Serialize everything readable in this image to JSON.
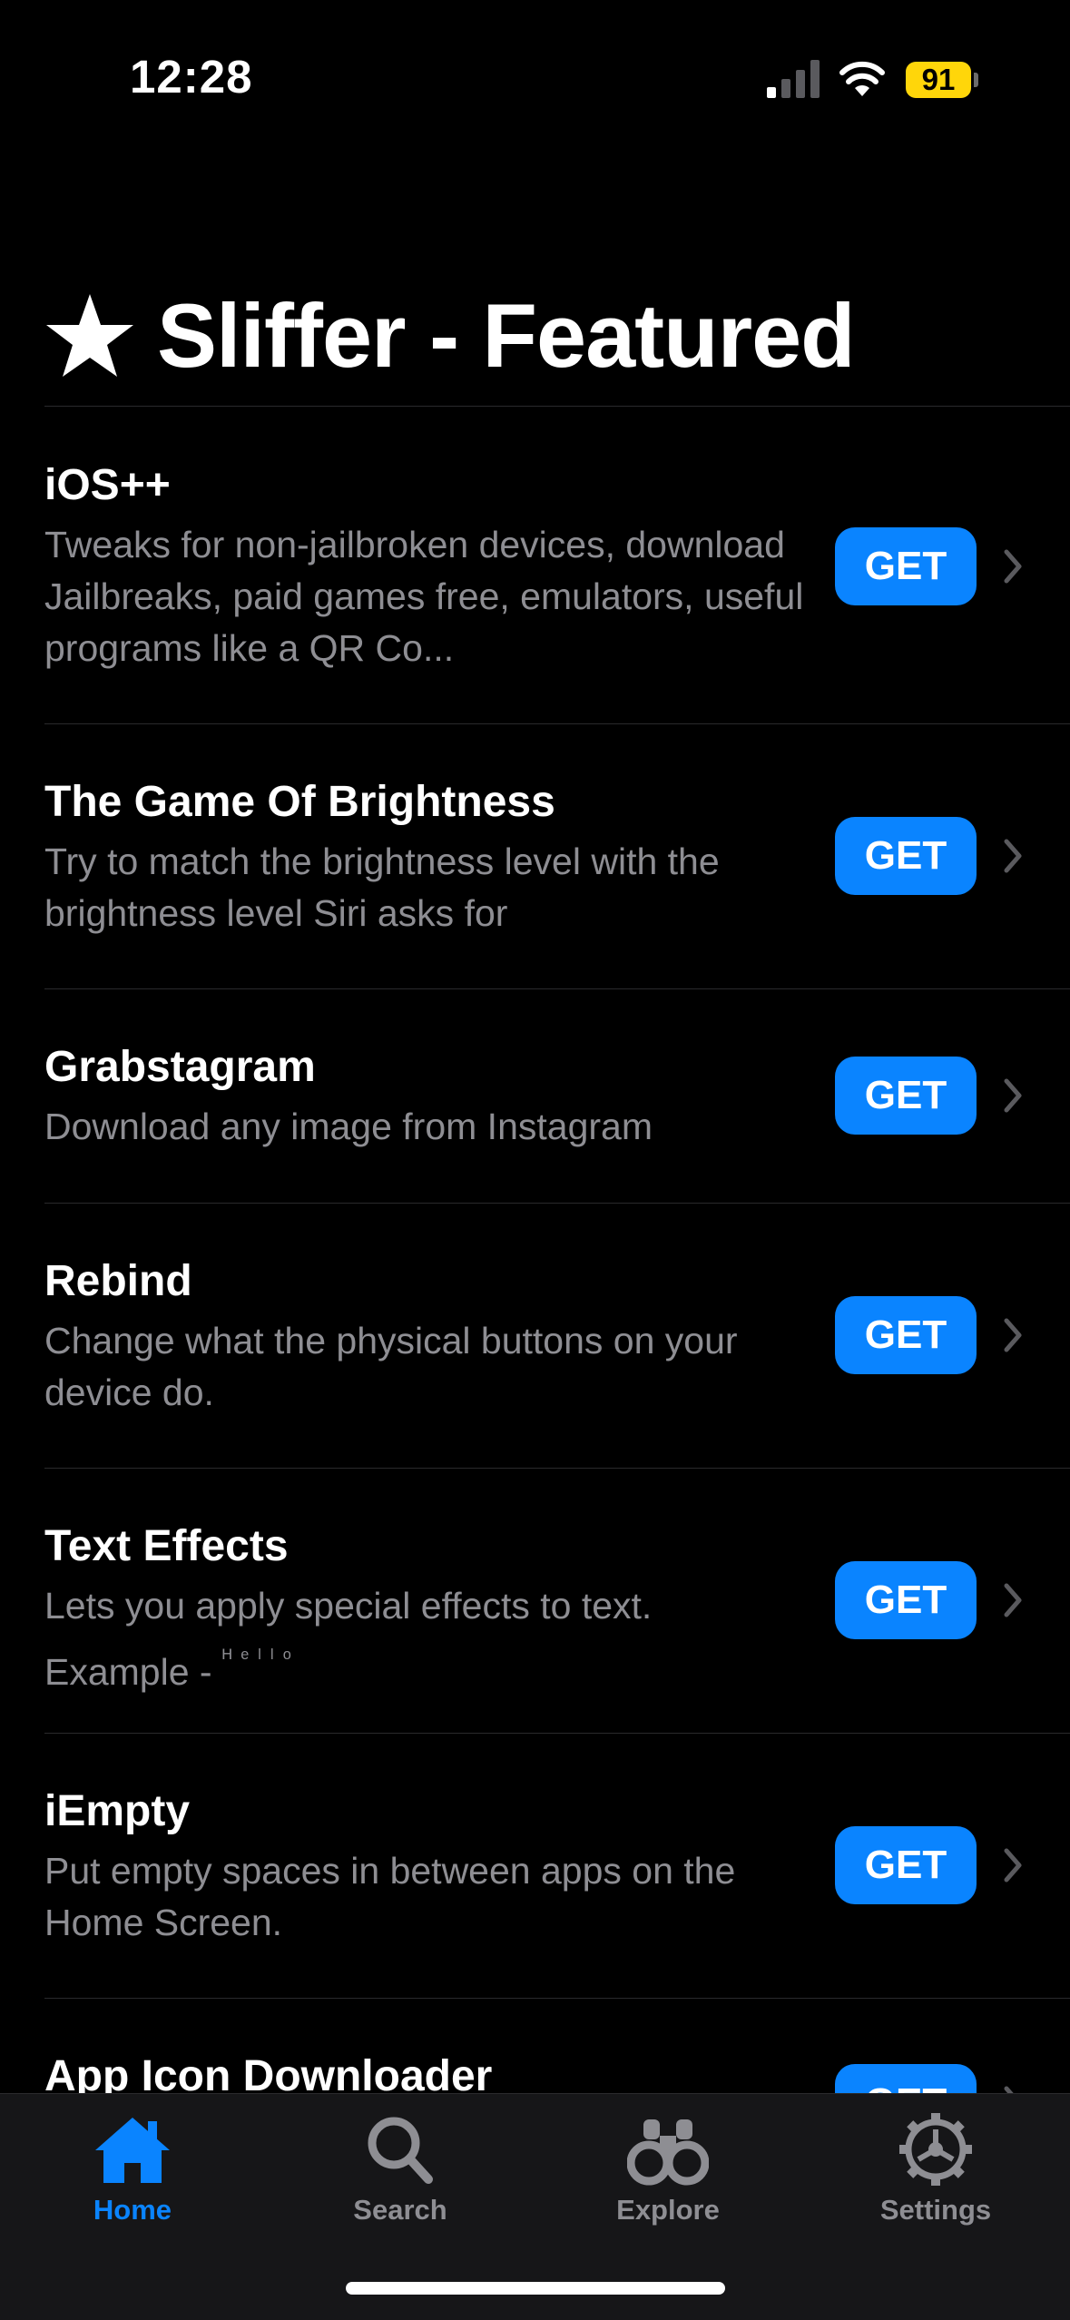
{
  "status_bar": {
    "time": "12:28",
    "battery": "91"
  },
  "header": {
    "title": "Sliffer - Featured"
  },
  "items": [
    {
      "name": "iOS++",
      "description": "Tweaks for non-jailbroken devices, download Jailbreaks, paid games free, emulators, useful programs like a QR Co...",
      "button": "GET"
    },
    {
      "name": "The Game Of Brightness",
      "description": "Try to match the brightness level with the brightness level Siri asks for",
      "button": "GET"
    },
    {
      "name": "Grabstagram",
      "description": "Download any image from Instagram",
      "button": "GET"
    },
    {
      "name": "Rebind",
      "description": "Change what the physical buttons on your device do.",
      "button": "GET"
    },
    {
      "name": "Text Effects",
      "description": "Lets you apply special effects to text. Example - ",
      "description_effect": "ᴴᵉˡˡᵒ",
      "button": "GET"
    },
    {
      "name": "iEmpty",
      "description": "Put empty spaces in between apps on the Home Screen.",
      "button": "GET"
    },
    {
      "name": "App Icon Downloader",
      "button": "GET"
    }
  ],
  "tabs": [
    {
      "label": "Home",
      "icon": "house-icon",
      "active": true
    },
    {
      "label": "Search",
      "icon": "magnifier-icon",
      "active": false
    },
    {
      "label": "Explore",
      "icon": "binoculars-icon",
      "active": false
    },
    {
      "label": "Settings",
      "icon": "gear-icon",
      "active": false
    }
  ],
  "colors": {
    "accent": "#0a84ff",
    "battery": "#ffd60a",
    "secondary_text": "#8e8e93",
    "background": "#000000"
  }
}
